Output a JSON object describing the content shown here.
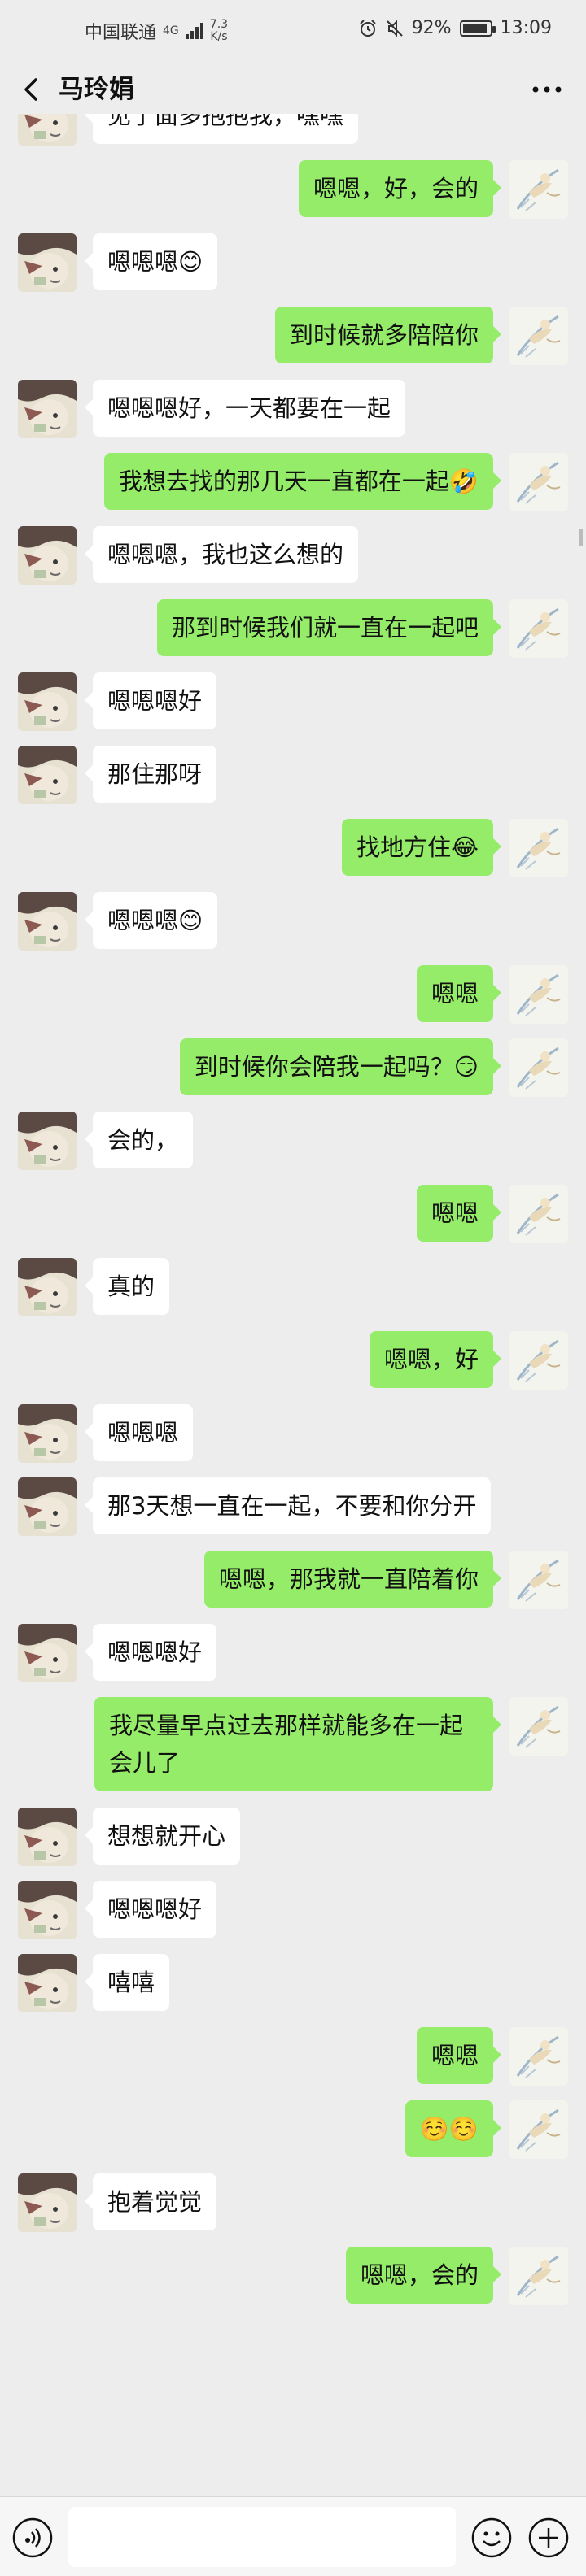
{
  "status_bar": {
    "carrier": "中国联通",
    "network": "4G",
    "speed_value": "7.3",
    "speed_unit": "K/s",
    "battery": "92%",
    "battery_level": 0.92,
    "time": "13:09"
  },
  "header": {
    "title": "马玲娟"
  },
  "input": {
    "placeholder": ""
  },
  "messages": [
    {
      "side": "in",
      "text": "见了面多抱抱我，嘿嘿"
    },
    {
      "side": "out",
      "text": "嗯嗯，好，会的"
    },
    {
      "side": "in",
      "text": "嗯嗯嗯😊"
    },
    {
      "side": "out",
      "text": "到时候就多陪陪你"
    },
    {
      "side": "in",
      "text": "嗯嗯嗯好，一天都要在一起"
    },
    {
      "side": "out",
      "text": "我想去找的那几天一直都在一起🤣"
    },
    {
      "side": "in",
      "text": "嗯嗯嗯，我也这么想的"
    },
    {
      "side": "out",
      "text": "那到时候我们就一直在一起吧"
    },
    {
      "side": "in",
      "text": "嗯嗯嗯好"
    },
    {
      "side": "in",
      "text": "那住那呀"
    },
    {
      "side": "out",
      "text": "找地方住😂"
    },
    {
      "side": "in",
      "text": "嗯嗯嗯😊"
    },
    {
      "side": "out",
      "text": "嗯嗯"
    },
    {
      "side": "out",
      "text": "到时候你会陪我一起吗？😏"
    },
    {
      "side": "in",
      "text": "会的，"
    },
    {
      "side": "out",
      "text": "嗯嗯"
    },
    {
      "side": "in",
      "text": "真的"
    },
    {
      "side": "out",
      "text": "嗯嗯，好"
    },
    {
      "side": "in",
      "text": "嗯嗯嗯"
    },
    {
      "side": "in",
      "text": "那3天想一直在一起，不要和你分开"
    },
    {
      "side": "out",
      "text": "嗯嗯，那我就一直陪着你"
    },
    {
      "side": "in",
      "text": "嗯嗯嗯好"
    },
    {
      "side": "out",
      "text": "我尽量早点过去那样就能多在一起会儿了"
    },
    {
      "side": "in",
      "text": "想想就开心"
    },
    {
      "side": "in",
      "text": "嗯嗯嗯好"
    },
    {
      "side": "in",
      "text": "嘻嘻"
    },
    {
      "side": "out",
      "text": "嗯嗯"
    },
    {
      "side": "out",
      "text": "☺️☺️"
    },
    {
      "side": "in",
      "text": "抱着觉觉"
    },
    {
      "side": "out",
      "text": "嗯嗯，会的"
    }
  ]
}
